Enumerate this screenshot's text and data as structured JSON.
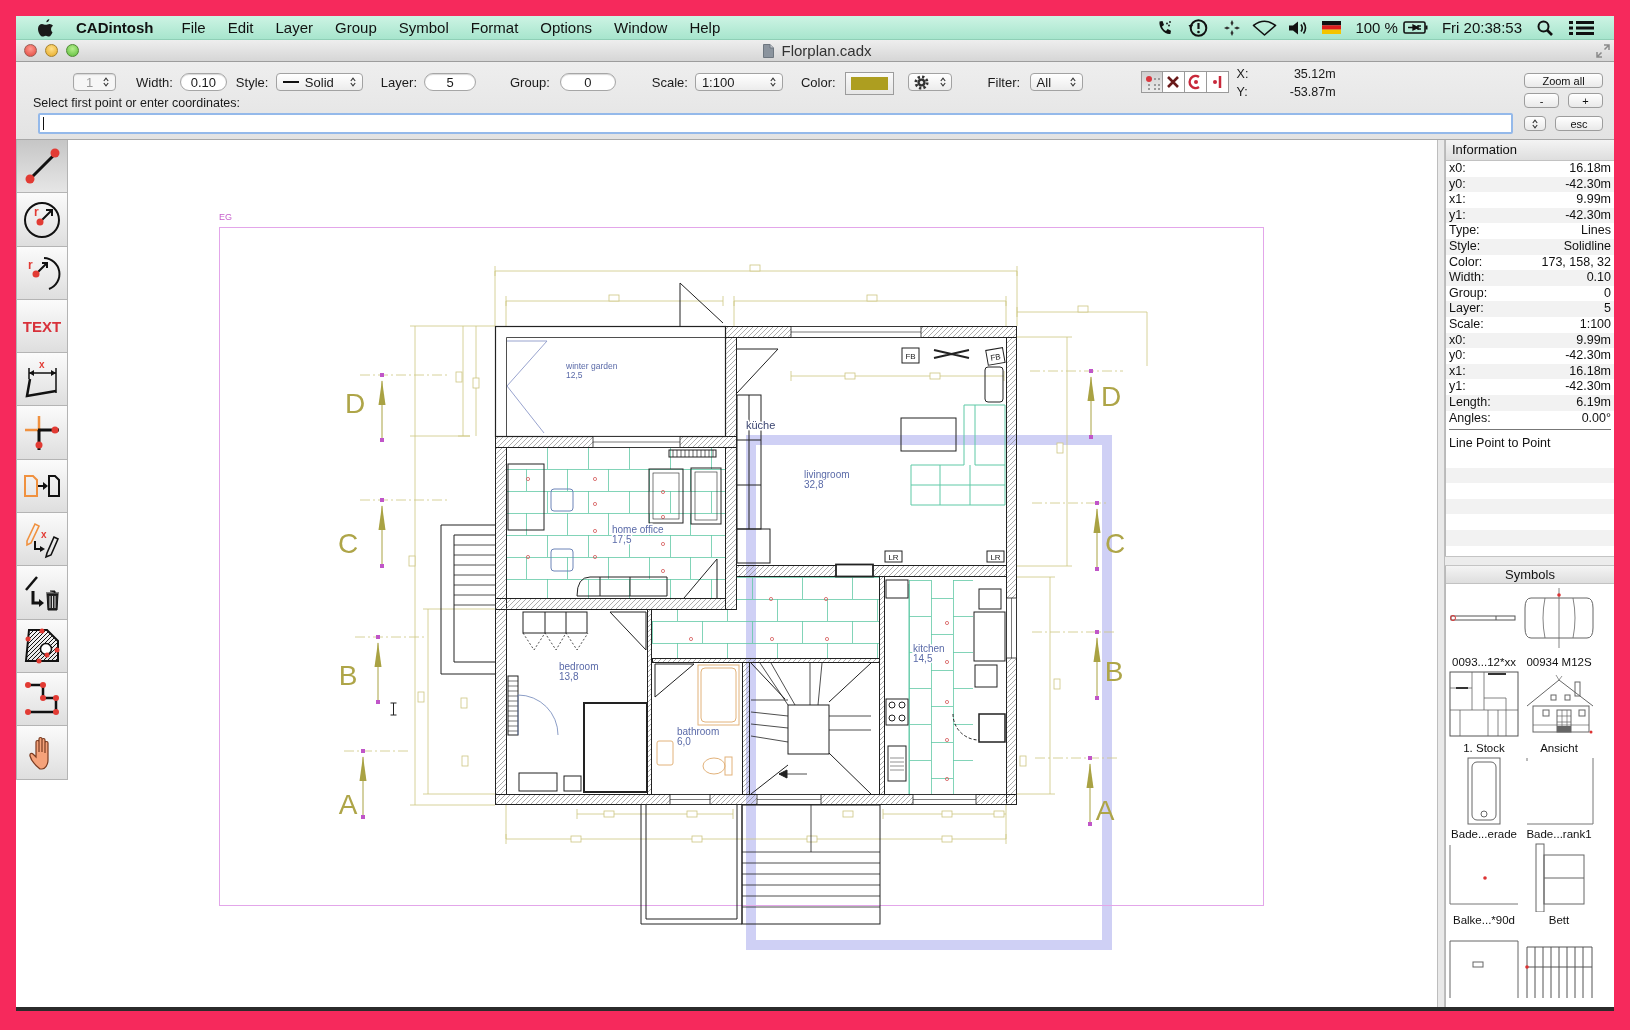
{
  "menubar": {
    "app": "CADintosh",
    "menus": [
      "File",
      "Edit",
      "Layer",
      "Group",
      "Symbol",
      "Format",
      "Options",
      "Window",
      "Help"
    ],
    "battery": "100 %",
    "clock": "Fri 20:38:53"
  },
  "window": {
    "title": "Florplan.cadx"
  },
  "toolbar": {
    "number_field": {
      "value": "1",
      "disabled": true
    },
    "width": {
      "label": "Width:",
      "value": "0.10"
    },
    "style": {
      "label": "Style:",
      "value": "Solid"
    },
    "layer": {
      "label": "Layer:",
      "value": "5"
    },
    "group": {
      "label": "Group:",
      "value": "0"
    },
    "scale": {
      "label": "Scale:",
      "value": "1:100"
    },
    "color": {
      "label": "Color:",
      "color": "#ad9e20"
    },
    "filter": {
      "label": "Filter:",
      "value": "All"
    },
    "snaps": [
      {
        "kind": "grid",
        "selected": true
      },
      {
        "kind": "intersection",
        "selected": false
      },
      {
        "kind": "center",
        "selected": false
      },
      {
        "kind": "perpendicular",
        "selected": false
      }
    ],
    "coordinates": [
      {
        "label": "X:",
        "value": "35.12m"
      },
      {
        "label": "Y:",
        "value": "-53.87m"
      }
    ],
    "zoom_buttons": [
      "Zoom all",
      "-",
      "+"
    ]
  },
  "command": {
    "prompt": "Select first point or enter coordinates:",
    "cancel": "esc"
  },
  "tools": [
    {
      "kind": "line",
      "selected": true
    },
    {
      "kind": "circle",
      "letter": "r",
      "selected": false
    },
    {
      "kind": "arc",
      "letter": "r",
      "selected": false
    },
    {
      "kind": "text",
      "label": "TEXT",
      "selected": false
    },
    {
      "kind": "dimension",
      "letter": "x",
      "selected": false
    },
    {
      "kind": "corner",
      "selected": false
    },
    {
      "kind": "copy",
      "selected": false
    },
    {
      "kind": "edit",
      "letter": "x",
      "selected": false
    },
    {
      "kind": "delete",
      "selected": false
    },
    {
      "kind": "hatch",
      "selected": false
    },
    {
      "kind": "polyline",
      "selected": false
    },
    {
      "kind": "pan",
      "selected": false
    }
  ],
  "plan": {
    "sheet": "EG",
    "rooms": [
      {
        "name": "winter garden",
        "area": "12,5"
      },
      {
        "name": "livingroom",
        "area": "32,8"
      },
      {
        "name": "home office",
        "area": "17,5"
      },
      {
        "name": "kitchen",
        "area": "14,5"
      },
      {
        "name": "bedroom",
        "area": "13,8"
      },
      {
        "name": "bathroom",
        "area": "6,0"
      }
    ],
    "labels": [
      "küche"
    ],
    "tags": [
      "FB",
      "FB",
      "LR",
      "LR"
    ],
    "sections": {
      "left": [
        "D",
        "C",
        "B",
        "A"
      ],
      "right": [
        "D",
        "C",
        "B",
        "A"
      ]
    }
  },
  "information": {
    "title": "Information",
    "rows": [
      {
        "label": "x0:",
        "value": "16.18m"
      },
      {
        "label": "y0:",
        "value": "-42.30m"
      },
      {
        "label": "x1:",
        "value": "9.99m"
      },
      {
        "label": "y1:",
        "value": "-42.30m"
      },
      {
        "label": "Type:",
        "value": "Lines"
      },
      {
        "label": "Style:",
        "value": "Solidline"
      },
      {
        "label": "Color:",
        "value": "173, 158, 32"
      },
      {
        "label": "Width:",
        "value": "0.10"
      },
      {
        "label": "Group:",
        "value": "0"
      },
      {
        "label": "Layer:",
        "value": "5"
      },
      {
        "label": "Scale:",
        "value": "1:100"
      },
      {
        "label": "x0:",
        "value": "9.99m"
      },
      {
        "label": "y0:",
        "value": "-42.30m"
      },
      {
        "label": "x1:",
        "value": "16.18m"
      },
      {
        "label": "y1:",
        "value": "-42.30m"
      },
      {
        "label": "Length:",
        "value": "6.19m"
      },
      {
        "label": "Angles:",
        "value": "0.00°"
      }
    ],
    "mode": "Line Point to Point"
  },
  "symbols": {
    "title": "Symbols",
    "items": [
      {
        "kind": "rod",
        "label": "0093...12*xx"
      },
      {
        "kind": "car",
        "label": "00934 M12S"
      },
      {
        "kind": "plan",
        "label": "1. Stock"
      },
      {
        "kind": "house",
        "label": "Ansicht"
      },
      {
        "kind": "bathtub",
        "label": "Bade...erade"
      },
      {
        "kind": "cabinet",
        "label": "Bade...rank1"
      },
      {
        "kind": "point",
        "label": "Balke...*90d"
      },
      {
        "kind": "bed",
        "label": "Bett"
      },
      {
        "kind": "frame"
      },
      {
        "kind": "railing"
      }
    ]
  }
}
